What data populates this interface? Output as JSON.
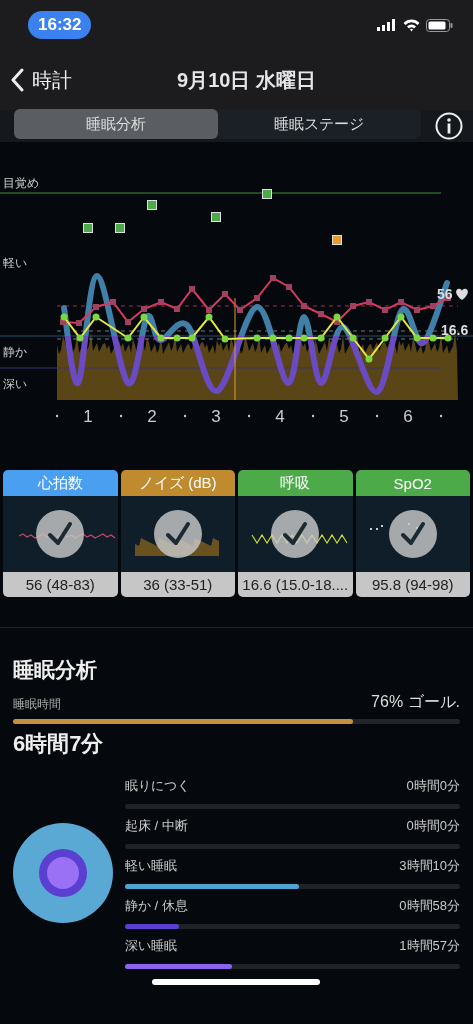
{
  "status_bar": {
    "time": "16:32"
  },
  "nav": {
    "back_label": "時計",
    "title": "9月10日 水曜日"
  },
  "segments": [
    {
      "label": "睡眠分析",
      "selected": true
    },
    {
      "label": "睡眠ステージ",
      "selected": false
    }
  ],
  "chart": {
    "y_labels": [
      "目覚め",
      "軽い",
      "静か",
      "深い"
    ],
    "x_labels": [
      "1",
      "2",
      "3",
      "4",
      "5",
      "6"
    ],
    "heart_rate_label": "56",
    "respiration_label": "16.6"
  },
  "metric_cards": [
    {
      "kind": "heart",
      "title": "心拍数",
      "color": "#4a9ff0",
      "value": "56 (48-83)"
    },
    {
      "kind": "noise",
      "title": "ノイズ (dB)",
      "color": "#c08a2e",
      "value": "36 (33-51)"
    },
    {
      "kind": "breath",
      "title": "呼吸",
      "color": "#4caa48",
      "value": "16.6 (15.0-18...."
    },
    {
      "kind": "spo2",
      "title": "SpO2",
      "color": "#4caa48",
      "value": "95.8 (94-98)"
    }
  ],
  "analysis": {
    "title": "睡眠分析",
    "duration_label": "睡眠時間",
    "goal_text": "76% ゴール.",
    "level": 0.76,
    "duration": "6時間7分"
  },
  "stages": [
    {
      "name": "眠りにつく",
      "value": "0時間0分"
    },
    {
      "name": "起床 / 中断",
      "value": "0時間0分"
    },
    {
      "name": "軽い睡眠",
      "value": "3時間10分",
      "level": 0.52,
      "color": "#4fa3d1"
    },
    {
      "name": "静か / 休息",
      "value": "0時間58分",
      "level": 0.16,
      "color": "#5b3fd0"
    },
    {
      "name": "深い睡眠",
      "value": "1時間57分",
      "level": 0.32,
      "color": "#8a63f0"
    }
  ]
}
